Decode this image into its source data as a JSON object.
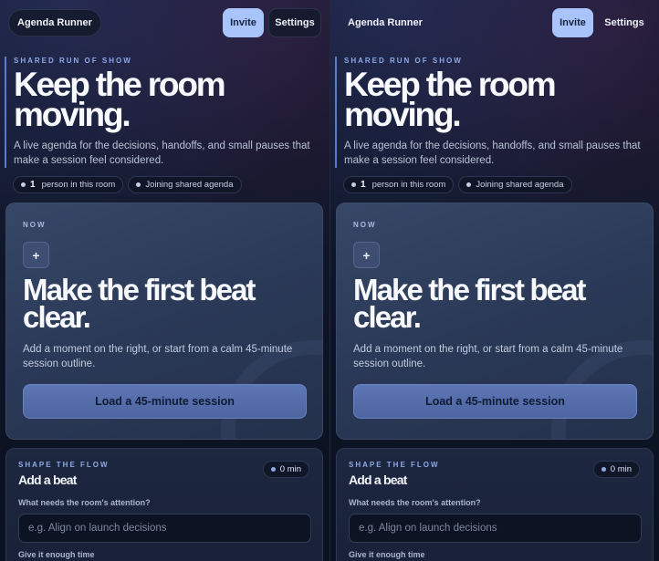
{
  "topbar": {
    "brand": "Agenda Runner",
    "invite_label": "Invite",
    "settings_label": "Settings"
  },
  "hero": {
    "eyebrow": "SHARED RUN OF SHOW",
    "title": "Keep the room moving.",
    "subtitle": "A live agenda for the decisions, handoffs, and small pauses that make a session feel considered."
  },
  "presence": {
    "count": "1",
    "count_label": "person in this room",
    "status": "Joining shared agenda"
  },
  "now_card": {
    "eyebrow": "NOW",
    "add_glyph": "+",
    "title": "Make the first beat clear.",
    "subtitle": "Add a moment on the right, or start from a calm 45-minute session outline.",
    "load_label": "Load a 45-minute session"
  },
  "flow_card": {
    "eyebrow": "SHAPE THE FLOW",
    "title": "Add a beat",
    "total_minutes": "0 min",
    "attention_label": "What needs the room's attention?",
    "attention_placeholder": "e.g. Align on launch decisions",
    "time_label": "Give it enough time"
  },
  "colors": {
    "accent": "#a9c4fb",
    "background": "#0b1322",
    "card": "#2a3957"
  }
}
